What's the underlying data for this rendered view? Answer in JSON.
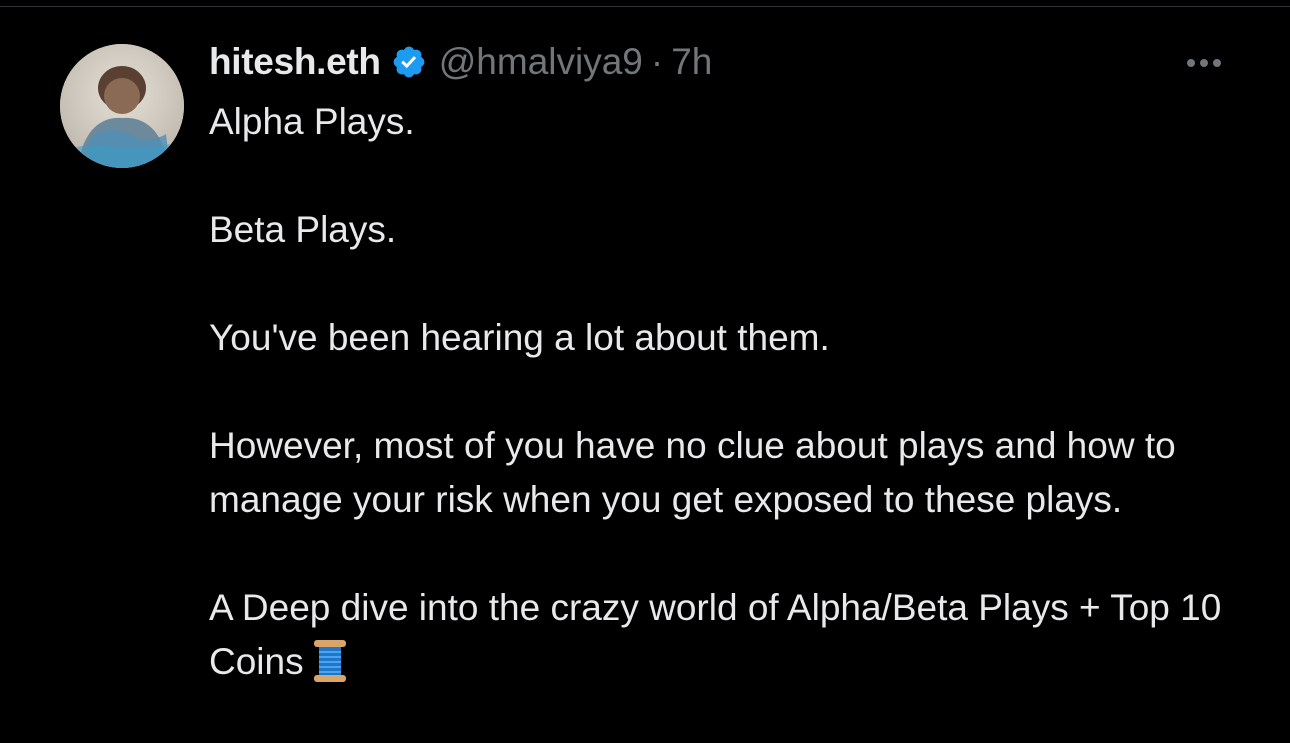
{
  "tweet": {
    "display_name": "hitesh.eth",
    "verified": true,
    "handle": "@hmalviya9",
    "separator": "·",
    "time": "7h",
    "paragraphs": [
      "Alpha Plays.",
      "Beta Plays.",
      "You've been hearing a lot about them.",
      "However, most of you have no clue about plays and how to manage your risk when you get exposed to these plays.",
      "A Deep dive into the crazy world of Alpha/Beta Plays + Top 10 Coins"
    ]
  },
  "icons": {
    "verified": "verified-badge-icon",
    "more": "more-options-icon",
    "emoji": "thread-spool-emoji"
  },
  "colors": {
    "background": "#000000",
    "primary_text": "#e7e9ea",
    "secondary_text": "#71767b",
    "verified_blue": "#1d9bf0"
  }
}
